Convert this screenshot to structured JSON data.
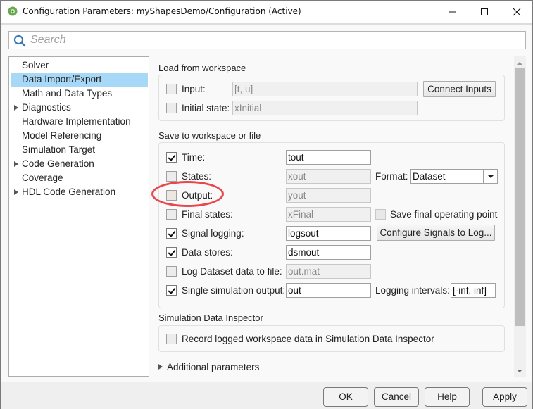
{
  "window": {
    "title": "Configuration Parameters: myShapesDemo/Configuration (Active)",
    "app_icon": "simulink-gear-icon",
    "controls": {
      "minimize": "minimize-icon",
      "maximize": "maximize-icon",
      "close": "close-icon"
    }
  },
  "search": {
    "placeholder": "Search",
    "value": ""
  },
  "tree": {
    "items": [
      {
        "label": "Solver",
        "expandable": false,
        "selected": false
      },
      {
        "label": "Data Import/Export",
        "expandable": false,
        "selected": true
      },
      {
        "label": "Math and Data Types",
        "expandable": false,
        "selected": false
      },
      {
        "label": "Diagnostics",
        "expandable": true,
        "selected": false
      },
      {
        "label": "Hardware Implementation",
        "expandable": false,
        "selected": false
      },
      {
        "label": "Model Referencing",
        "expandable": false,
        "selected": false
      },
      {
        "label": "Simulation Target",
        "expandable": false,
        "selected": false
      },
      {
        "label": "Code Generation",
        "expandable": true,
        "selected": false
      },
      {
        "label": "Coverage",
        "expandable": false,
        "selected": false
      },
      {
        "label": "HDL Code Generation",
        "expandable": true,
        "selected": false
      }
    ]
  },
  "load": {
    "title": "Load from workspace",
    "input": {
      "label": "Input:",
      "checked": false,
      "value": "[t, u]"
    },
    "initial_state": {
      "label": "Initial state:",
      "checked": false,
      "value": "xInitial"
    },
    "connect_inputs_label": "Connect Inputs"
  },
  "save": {
    "title": "Save to workspace or file",
    "time": {
      "label": "Time:",
      "checked": true,
      "value": "tout"
    },
    "states": {
      "label": "States:",
      "checked": false,
      "value": "xout"
    },
    "format": {
      "label": "Format:",
      "selected": "Dataset"
    },
    "output": {
      "label": "Output:",
      "checked": false,
      "value": "yout",
      "highlighted": true
    },
    "final_states": {
      "label": "Final states:",
      "checked": false,
      "value": "xFinal"
    },
    "save_final_op": {
      "label": "Save final operating point",
      "checked": false
    },
    "signal_logging": {
      "label": "Signal logging:",
      "checked": true,
      "value": "logsout"
    },
    "configure_signals_label": "Configure Signals to Log...",
    "data_stores": {
      "label": "Data stores:",
      "checked": true,
      "value": "dsmout"
    },
    "log_dataset": {
      "label": "Log Dataset data to file:",
      "checked": false,
      "value": "out.mat"
    },
    "single_output": {
      "label": "Single simulation output:",
      "checked": true,
      "value": "out"
    },
    "logging_intervals": {
      "label": "Logging intervals:",
      "value": "[-inf, inf]"
    }
  },
  "sdi": {
    "title": "Simulation Data Inspector",
    "record": {
      "label": "Record logged workspace data in Simulation Data Inspector",
      "checked": false
    }
  },
  "additional": {
    "label": "Additional parameters"
  },
  "footer": {
    "ok": "OK",
    "cancel": "Cancel",
    "help": "Help",
    "apply": "Apply"
  },
  "colors": {
    "selection": "#a8d8f8",
    "highlight_ellipse": "#e5343a"
  }
}
